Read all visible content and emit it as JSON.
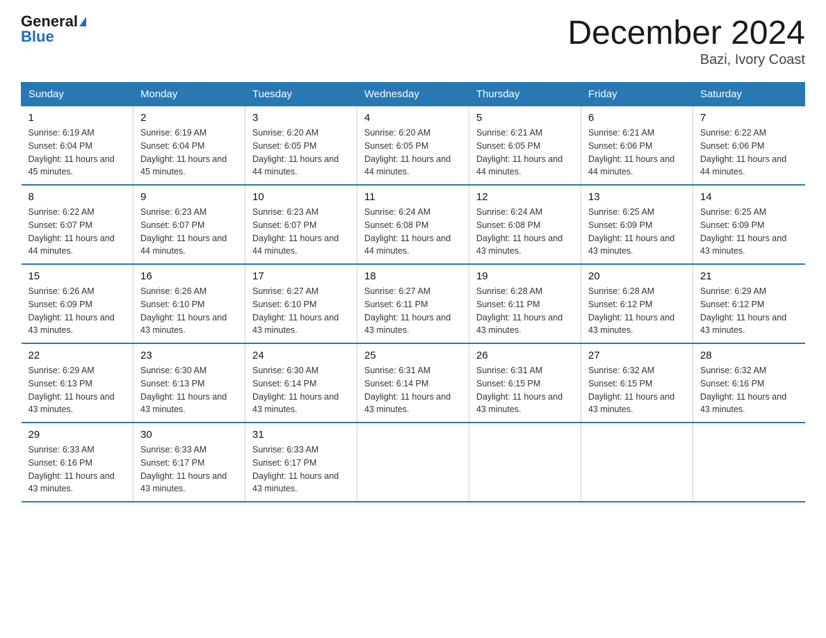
{
  "logo": {
    "general": "General",
    "blue": "Blue"
  },
  "title": "December 2024",
  "subtitle": "Bazi, Ivory Coast",
  "weekdays": [
    "Sunday",
    "Monday",
    "Tuesday",
    "Wednesday",
    "Thursday",
    "Friday",
    "Saturday"
  ],
  "weeks": [
    [
      {
        "day": "1",
        "sunrise": "6:19 AM",
        "sunset": "6:04 PM",
        "daylight": "11 hours and 45 minutes."
      },
      {
        "day": "2",
        "sunrise": "6:19 AM",
        "sunset": "6:04 PM",
        "daylight": "11 hours and 45 minutes."
      },
      {
        "day": "3",
        "sunrise": "6:20 AM",
        "sunset": "6:05 PM",
        "daylight": "11 hours and 44 minutes."
      },
      {
        "day": "4",
        "sunrise": "6:20 AM",
        "sunset": "6:05 PM",
        "daylight": "11 hours and 44 minutes."
      },
      {
        "day": "5",
        "sunrise": "6:21 AM",
        "sunset": "6:05 PM",
        "daylight": "11 hours and 44 minutes."
      },
      {
        "day": "6",
        "sunrise": "6:21 AM",
        "sunset": "6:06 PM",
        "daylight": "11 hours and 44 minutes."
      },
      {
        "day": "7",
        "sunrise": "6:22 AM",
        "sunset": "6:06 PM",
        "daylight": "11 hours and 44 minutes."
      }
    ],
    [
      {
        "day": "8",
        "sunrise": "6:22 AM",
        "sunset": "6:07 PM",
        "daylight": "11 hours and 44 minutes."
      },
      {
        "day": "9",
        "sunrise": "6:23 AM",
        "sunset": "6:07 PM",
        "daylight": "11 hours and 44 minutes."
      },
      {
        "day": "10",
        "sunrise": "6:23 AM",
        "sunset": "6:07 PM",
        "daylight": "11 hours and 44 minutes."
      },
      {
        "day": "11",
        "sunrise": "6:24 AM",
        "sunset": "6:08 PM",
        "daylight": "11 hours and 44 minutes."
      },
      {
        "day": "12",
        "sunrise": "6:24 AM",
        "sunset": "6:08 PM",
        "daylight": "11 hours and 43 minutes."
      },
      {
        "day": "13",
        "sunrise": "6:25 AM",
        "sunset": "6:09 PM",
        "daylight": "11 hours and 43 minutes."
      },
      {
        "day": "14",
        "sunrise": "6:25 AM",
        "sunset": "6:09 PM",
        "daylight": "11 hours and 43 minutes."
      }
    ],
    [
      {
        "day": "15",
        "sunrise": "6:26 AM",
        "sunset": "6:09 PM",
        "daylight": "11 hours and 43 minutes."
      },
      {
        "day": "16",
        "sunrise": "6:26 AM",
        "sunset": "6:10 PM",
        "daylight": "11 hours and 43 minutes."
      },
      {
        "day": "17",
        "sunrise": "6:27 AM",
        "sunset": "6:10 PM",
        "daylight": "11 hours and 43 minutes."
      },
      {
        "day": "18",
        "sunrise": "6:27 AM",
        "sunset": "6:11 PM",
        "daylight": "11 hours and 43 minutes."
      },
      {
        "day": "19",
        "sunrise": "6:28 AM",
        "sunset": "6:11 PM",
        "daylight": "11 hours and 43 minutes."
      },
      {
        "day": "20",
        "sunrise": "6:28 AM",
        "sunset": "6:12 PM",
        "daylight": "11 hours and 43 minutes."
      },
      {
        "day": "21",
        "sunrise": "6:29 AM",
        "sunset": "6:12 PM",
        "daylight": "11 hours and 43 minutes."
      }
    ],
    [
      {
        "day": "22",
        "sunrise": "6:29 AM",
        "sunset": "6:13 PM",
        "daylight": "11 hours and 43 minutes."
      },
      {
        "day": "23",
        "sunrise": "6:30 AM",
        "sunset": "6:13 PM",
        "daylight": "11 hours and 43 minutes."
      },
      {
        "day": "24",
        "sunrise": "6:30 AM",
        "sunset": "6:14 PM",
        "daylight": "11 hours and 43 minutes."
      },
      {
        "day": "25",
        "sunrise": "6:31 AM",
        "sunset": "6:14 PM",
        "daylight": "11 hours and 43 minutes."
      },
      {
        "day": "26",
        "sunrise": "6:31 AM",
        "sunset": "6:15 PM",
        "daylight": "11 hours and 43 minutes."
      },
      {
        "day": "27",
        "sunrise": "6:32 AM",
        "sunset": "6:15 PM",
        "daylight": "11 hours and 43 minutes."
      },
      {
        "day": "28",
        "sunrise": "6:32 AM",
        "sunset": "6:16 PM",
        "daylight": "11 hours and 43 minutes."
      }
    ],
    [
      {
        "day": "29",
        "sunrise": "6:33 AM",
        "sunset": "6:16 PM",
        "daylight": "11 hours and 43 minutes."
      },
      {
        "day": "30",
        "sunrise": "6:33 AM",
        "sunset": "6:17 PM",
        "daylight": "11 hours and 43 minutes."
      },
      {
        "day": "31",
        "sunrise": "6:33 AM",
        "sunset": "6:17 PM",
        "daylight": "11 hours and 43 minutes."
      },
      null,
      null,
      null,
      null
    ]
  ]
}
